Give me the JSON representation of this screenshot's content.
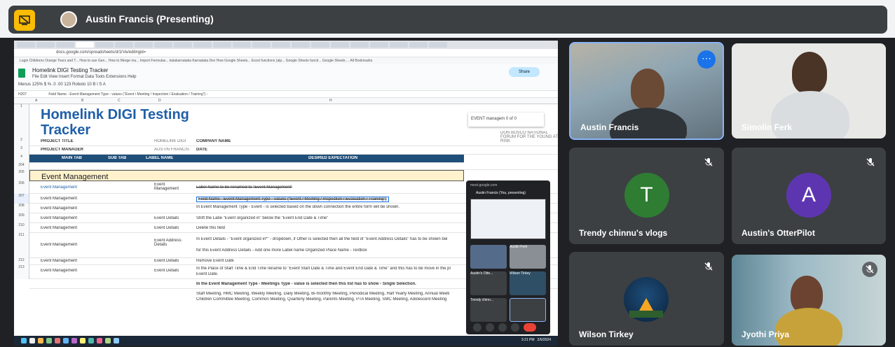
{
  "header": {
    "presenter_name": "Austin Francis (Presenting)",
    "present_icon": "present-screen-icon"
  },
  "shared_screen": {
    "url": "docs.google.com/spreadsheets/d/1rVe/edit#gid=",
    "bookmarks": "Login  Childrens  Orange Tours and T...  How to use Gen...  How to Merge mu...  Import Formulas...  kalakarnataka  Karnataka Dev  How Google Sheets...  Excel functions (alp...  Google Sheets functi...  Google Sheets ...   All Bookmarks",
    "doc_title": "Homelink DIGI Testing Tracker",
    "doc_menu": "File  Edit  View  Insert  Format  Data  Tools  Extensions  Help",
    "toolbar": "Menus    125%    $  %  .0  .00  123    Roboto    10    B  I  S  A",
    "share_label": "Share",
    "cell_ref": "H207",
    "formula": "Field Name - Event Management Type - values (\"Event / Meeting / Inspection / Evaluation / Training\") -",
    "find_text": "EVENT managem 0 of 0",
    "sheet_title": "Homelink DIGI Testing Tracker",
    "row_numbers": [
      "1",
      "2",
      "3",
      "4",
      "204",
      "205",
      "206",
      "207",
      "208",
      "209",
      "210",
      "211",
      "212",
      "213"
    ],
    "project_title_label": "PROJECT TITLE",
    "project_title_value": "HOMELINK DIGI",
    "company_label": "COMPANY NAME",
    "company_value": "DON BOSCO NATIONAL FORUM FOR THE YOUNG AT RISK",
    "pm_label": "PROJECT MANAGER",
    "pm_value": "AUSTIN FRANCIS",
    "date_label": "DATE",
    "headers": {
      "main_tab": "MAIN TAB",
      "sub_tab": "SUB TAB",
      "label_name": "LABEL NAME",
      "desired": "DESIRED EXPECTATION"
    },
    "section_title": "Event Management",
    "rows": [
      {
        "main": "Event Management",
        "label": "Event Management",
        "desc": "Label Name to be renamed to \"Event Management\""
      },
      {
        "main": "Event Management",
        "label": "",
        "desc": "Field Name - Event Management Type - values (\"Event / Meeting / Inspection / Evaluation / Training\")"
      },
      {
        "main": "Event Management",
        "label": "",
        "desc": "In Event Management Type - Event - is selected based on the down connection the entire form will be shown."
      },
      {
        "main": "Event Management",
        "label": "Event Details",
        "desc": "Shift the Labe \"Event organized in\" below the \"Event End Date & Time\""
      },
      {
        "main": "Event Management",
        "label": "Event Details",
        "desc": "Delete this field"
      },
      {
        "main": "Event Management",
        "label": "Event Address Details",
        "desc": "In Event Details - \"Event organized in*\" - dropdown, if Other is selected then all the field of \"Event Address Details\" has to be shown bel"
      },
      {
        "main": "Event Management",
        "label": "Event Details",
        "desc": "Remove Event Date"
      },
      {
        "main": "Event Management",
        "label": "Event Details",
        "desc": "In the Place of Start Time & End Time rename to \"Event Start Date & Time and Event End Date & Time\" and this has to be move in the pl"
      }
    ],
    "extra_line_1": "for this Event Address Details - Add one more Label name Organized Place Name - Textbox",
    "extra_line_2": "Event Date.",
    "extra_line_3": "In the Event Management Type - Meetings Type - value is selected then this list has to show - Single Selection.",
    "extra_line_4": "Staff Meeting, HMC Meeting, Weekly Meeting, Daily Meeting, Bi-monthly Meeting, Periodical Meeting, Half Yearly Meeting, Annual Meeti",
    "extra_line_5": "Children Committee Meeting, Common Meeting, Quarterly Meeting, Parents Meeting, PTA Meeting, SMC Meeting, Adolescent Meeting",
    "mini_meet": {
      "title": "meet.google.com",
      "self": "Austin Francis (You, presenting)",
      "tiles": [
        "",
        "Austin Ferk",
        "Austin's Otte...",
        "Wilson Tirkey",
        "Trendy chinn...",
        ""
      ]
    },
    "taskbar_time": "3:21 PM",
    "taskbar_date": "2/6/2024"
  },
  "participants": [
    {
      "name": "Austin Francis",
      "type": "video"
    },
    {
      "name": "Simolin Ferk",
      "type": "video"
    },
    {
      "name": "Trendy chinnu's vlogs",
      "initial": "T",
      "color": "#2e7d32"
    },
    {
      "name": "Austin's OtterPilot",
      "initial": "A",
      "color": "#5e35b1"
    },
    {
      "name": "Wilson Tirkey",
      "type": "image"
    },
    {
      "name": "Jyothi Priya",
      "type": "video"
    }
  ]
}
